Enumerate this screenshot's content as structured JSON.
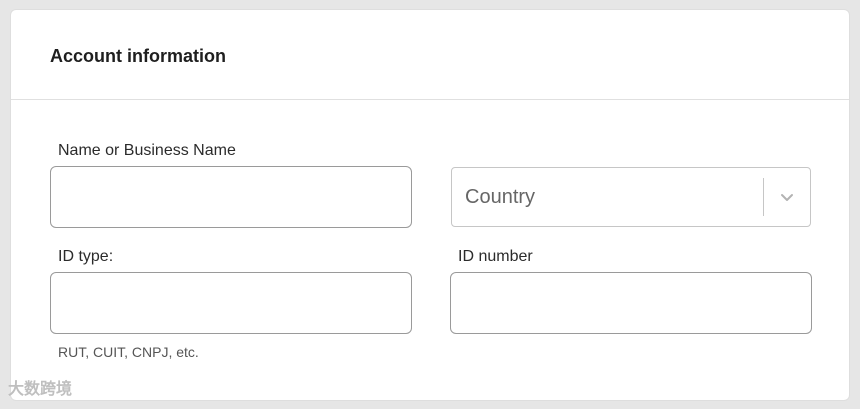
{
  "card": {
    "title": "Account information"
  },
  "form": {
    "name_label": "Name or Business Name",
    "name_value": "",
    "country_value": "Country",
    "id_type_label": "ID type:",
    "id_type_value": "",
    "id_type_hint": "RUT, CUIT, CNPJ, etc.",
    "id_number_label": "ID number",
    "id_number_value": ""
  },
  "icons": {
    "country_select": "chevron-down-icon"
  },
  "watermark": {
    "text": "大数跨境"
  },
  "colors": {
    "page_background": "#e6e6e6",
    "card_background": "#ffffff",
    "input_border": "#9a9a9a",
    "select_border": "#c6c6c6"
  }
}
